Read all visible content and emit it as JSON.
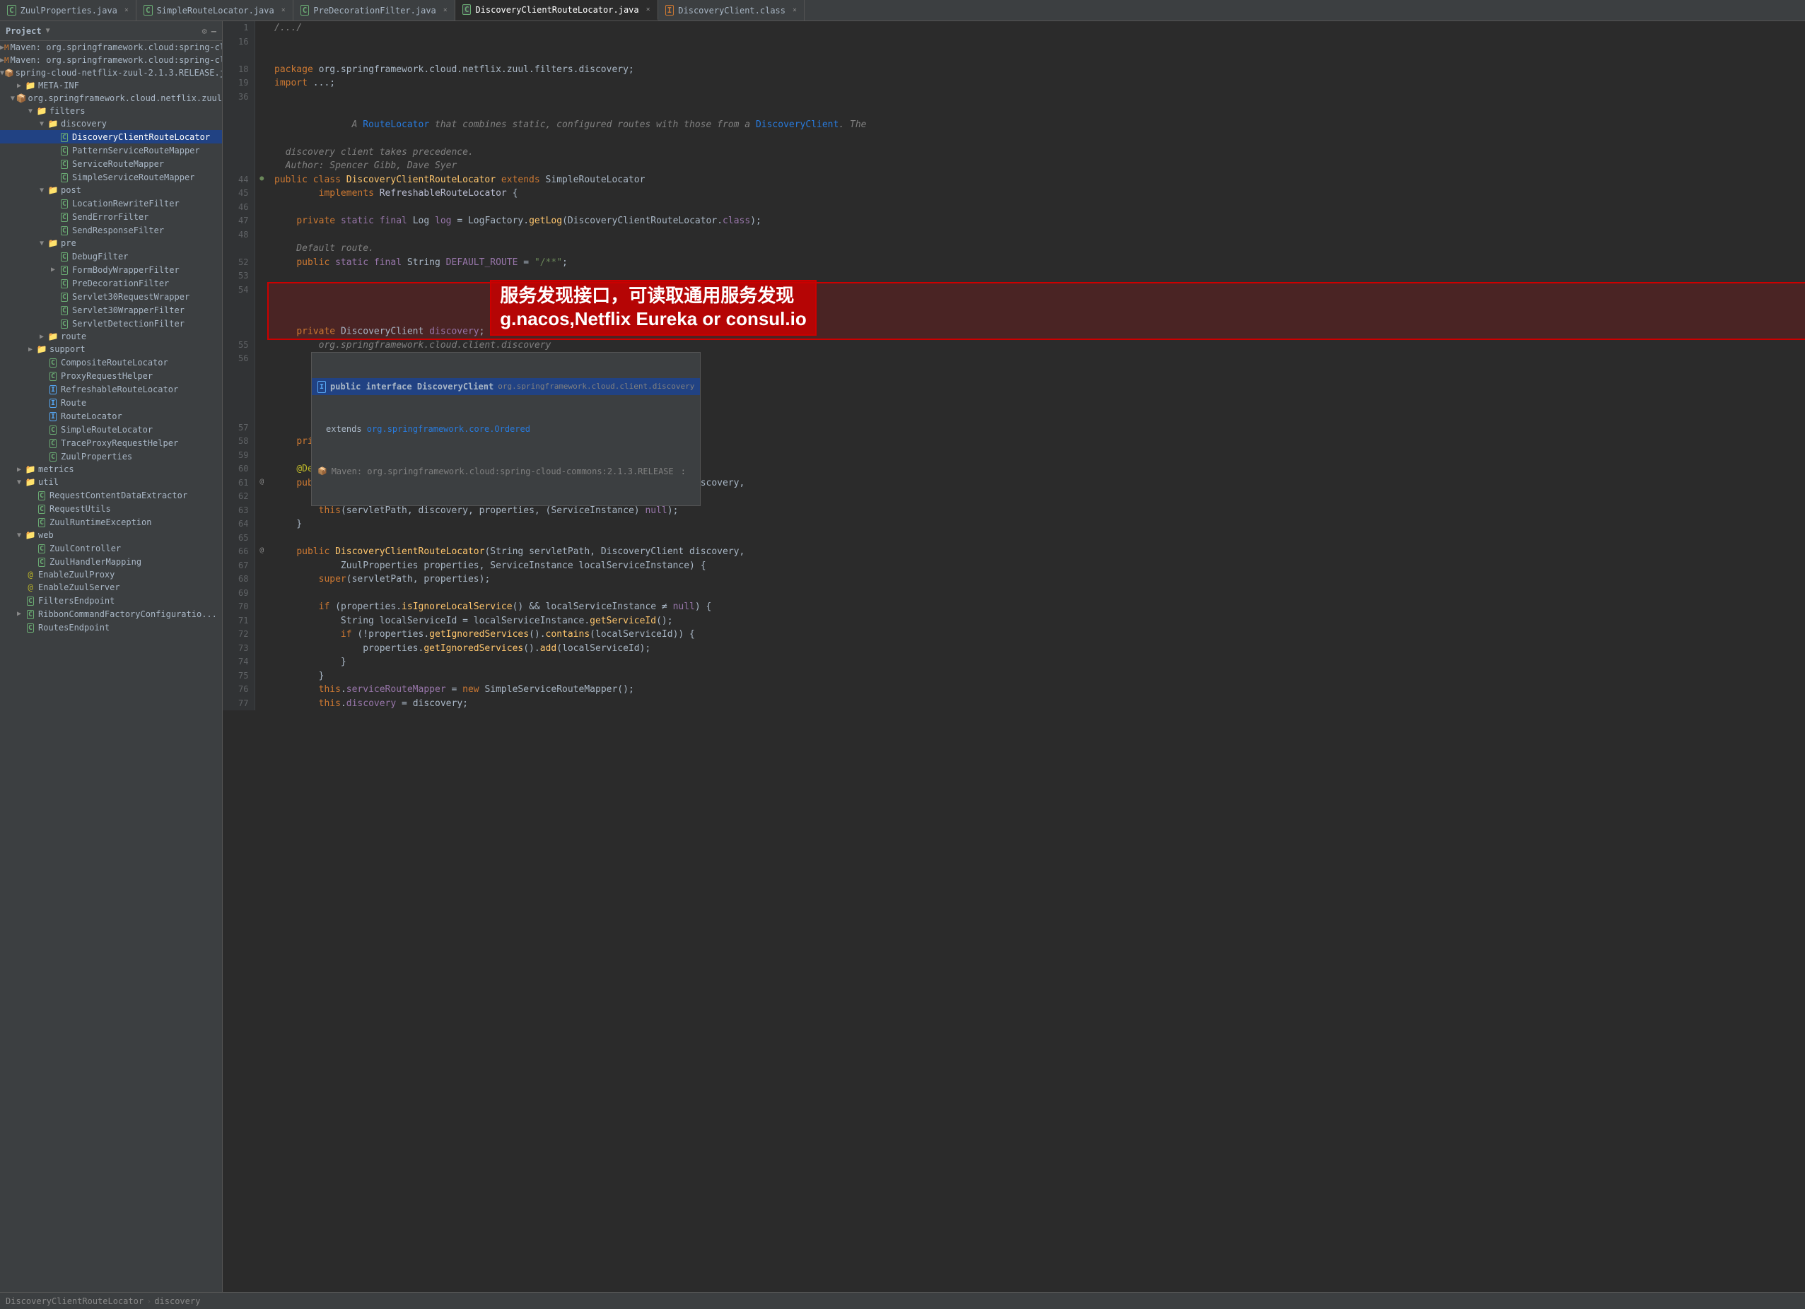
{
  "tabs": [
    {
      "id": "zuul-props",
      "label": "ZuulProperties.java",
      "icon": "c",
      "active": false
    },
    {
      "id": "simple-route",
      "label": "SimpleRouteLocator.java",
      "icon": "c",
      "active": false
    },
    {
      "id": "predecoration",
      "label": "PreDecorationFilter.java",
      "icon": "c",
      "active": false
    },
    {
      "id": "discovery-locator",
      "label": "DiscoveryClientRouteLocator.java",
      "icon": "c",
      "active": true
    },
    {
      "id": "discovery-class",
      "label": "DiscoveryClient.class",
      "icon": "class",
      "active": false
    }
  ],
  "project": {
    "header": "Project",
    "tree": []
  },
  "breadcrumb": {
    "parts": [
      "DiscoveryClientRouteLocator",
      "discovery"
    ]
  },
  "chinese_annotation": "服务发现接口，可读取通用服务发现\ng.nacos,Netflix Eureka or consul.io",
  "autocomplete": {
    "items": [
      {
        "icon": "i",
        "main": "public interface DiscoveryClient",
        "sub": "org.springframework.cloud.client.discovery",
        "selected": true
      },
      {
        "main": "extends org.springframework.core.Ordered",
        "icon": "none"
      },
      {
        "icon": "jar",
        "main": "Maven: org.springframework.cloud:spring-cloud-commons:2.1.3.RELEASE",
        "selected": false
      }
    ]
  }
}
